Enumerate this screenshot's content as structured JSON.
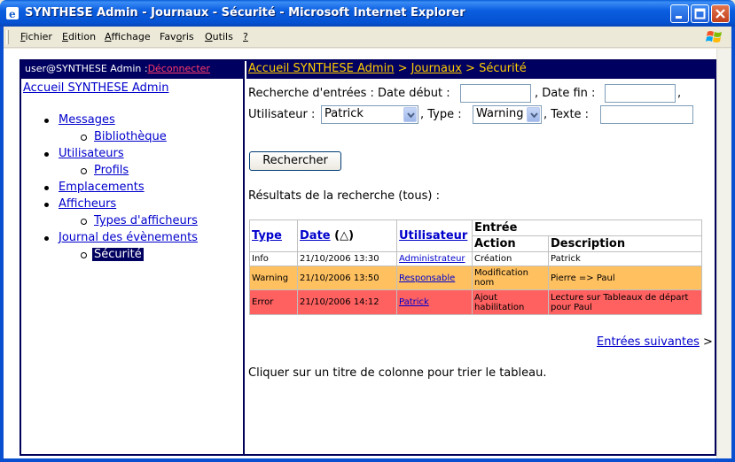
{
  "window": {
    "title": "SYNTHESE Admin - Journaux - Sécurité - Microsoft Internet Explorer",
    "icons": [
      "ie-icon",
      "minimize-icon",
      "maximize-icon",
      "close-icon",
      "windows-logo-icon"
    ]
  },
  "menu": {
    "items": [
      {
        "u": "F",
        "rest": "ichier"
      },
      {
        "u": "E",
        "rest": "dition"
      },
      {
        "u": "A",
        "rest": "ffichage"
      },
      {
        "pre": "Fav",
        "u": "o",
        "rest": "ris"
      },
      {
        "u": "O",
        "rest": "utils"
      },
      {
        "u": "?",
        "rest": ""
      }
    ]
  },
  "sidebar": {
    "user": "user@SYNTHESE Admin :",
    "logout": "Déconnecter",
    "home": "Accueil SYNTHESE Admin",
    "items": [
      {
        "label": "Messages",
        "sub": [
          "Bibliothèque"
        ]
      },
      {
        "label": "Utilisateurs",
        "sub": [
          "Profils"
        ]
      },
      {
        "label": "Emplacements",
        "sub": []
      },
      {
        "label": "Afficheurs",
        "sub": [
          "Types d'afficheurs"
        ]
      },
      {
        "label": "Journal des évènements",
        "sub": [
          "Sécurité"
        ]
      }
    ]
  },
  "breadcrumb": {
    "home": "Accueil SYNTHESE Admin",
    "sep": " > ",
    "journaux": "Journaux",
    "current": "Sécurité"
  },
  "search": {
    "label_start": "Recherche d'entrées : Date début :",
    "label_end": ", Date fin :",
    "trailing_comma": ",",
    "label_user": "Utilisateur :",
    "user_value": "Patrick",
    "label_type": ", Type :",
    "type_value": "Warning",
    "label_text": ", Texte :",
    "button": "Rechercher"
  },
  "results": {
    "label": "Résultats de la recherche (tous) :",
    "headers": {
      "type": "Type",
      "date": "Date",
      "date_sort": "(△)",
      "user": "Utilisateur",
      "entry": "Entrée",
      "action": "Action",
      "description": "Description"
    },
    "rows": [
      {
        "type": "Info",
        "date": "21/10/2006 13:30",
        "user": "Administrateur",
        "action": "Création",
        "description": "Patrick"
      },
      {
        "type": "Warning",
        "date": "21/10/2006 13:50",
        "user": "Responsable",
        "action": "Modification nom",
        "description": "Pierre => Paul"
      },
      {
        "type": "Error",
        "date": "21/10/2006 14:12",
        "user": "Patrick",
        "action": "Ajout habilitation",
        "description": "Lecture sur Tableaux de départ pour Paul"
      }
    ],
    "next": "Entrées suivantes",
    "next_arrow": ">",
    "hint": "Cliquer sur un titre de colonne pour trier le tableau."
  },
  "colors": {
    "header_bg": "#000060",
    "crumb_text": "#ffcc00",
    "warning_row": "#ffc060",
    "error_row": "#ff6060",
    "logout_link": "#ff3a6a"
  }
}
